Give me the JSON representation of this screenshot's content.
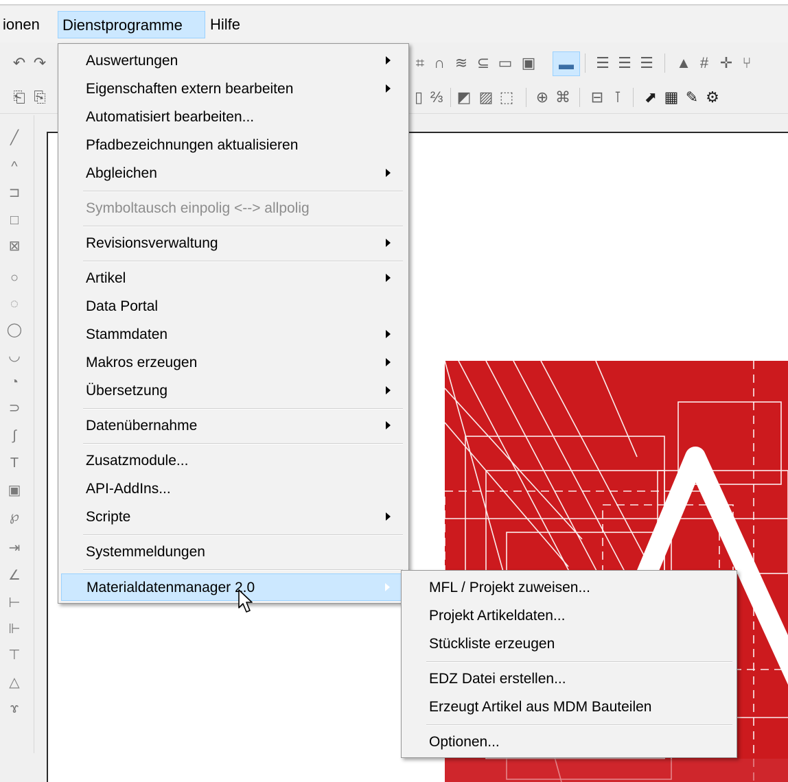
{
  "menubar": {
    "items": [
      "ionen",
      "Dienstprogramme",
      "Hilfe"
    ]
  },
  "main_menu": {
    "items": [
      {
        "label": "Auswertungen",
        "submenu": true
      },
      {
        "label": "Eigenschaften extern bearbeiten",
        "submenu": true
      },
      {
        "label": "Automatisiert bearbeiten...",
        "submenu": false
      },
      {
        "label": "Pfadbezeichnungen aktualisieren",
        "submenu": false
      },
      {
        "label": "Abgleichen",
        "submenu": true
      },
      {
        "label": "Symboltausch einpolig <--> allpolig",
        "submenu": false,
        "disabled": true
      },
      {
        "label": "Revisionsverwaltung",
        "submenu": true
      },
      {
        "label": "Artikel",
        "submenu": true
      },
      {
        "label": "Data Portal",
        "submenu": false
      },
      {
        "label": "Stammdaten",
        "submenu": true
      },
      {
        "label": "Makros erzeugen",
        "submenu": true
      },
      {
        "label": "Übersetzung",
        "submenu": true
      },
      {
        "label": "Datenübernahme",
        "submenu": true
      },
      {
        "label": "Zusatzmodule...",
        "submenu": false
      },
      {
        "label": "API-AddIns...",
        "submenu": false
      },
      {
        "label": "Scripte",
        "submenu": true
      },
      {
        "label": "Systemmeldungen",
        "submenu": false
      },
      {
        "label": "Materialdatenmanager 2.0",
        "submenu": true,
        "highlighted": true
      }
    ]
  },
  "sub_menu": {
    "items": [
      {
        "label": "MFL / Projekt zuweisen..."
      },
      {
        "label": "Projekt Artikeldaten..."
      },
      {
        "label": "Stückliste erzeugen"
      },
      {
        "label": "EDZ Datei erstellen..."
      },
      {
        "label": "Erzeugt Artikel aus MDM Bauteilen"
      },
      {
        "label": "Optionen..."
      }
    ]
  },
  "colors": {
    "menu_bg": "#f2f2f2",
    "highlight_bg": "#cce8ff",
    "highlight_border": "#99d1ff",
    "logo_red": "#cc1a1e"
  },
  "icons": {
    "toolbar": [
      "undo-icon",
      "redo-icon",
      "page-icon",
      "connect-icon",
      "scale-icon",
      "grid-icon",
      "export-icon",
      "table-icon",
      "script-icon",
      "settings-icon"
    ],
    "left_tools": [
      "line-icon",
      "polyline-icon",
      "rectangle-icon",
      "circle-icon",
      "arc-icon",
      "text-icon",
      "image-icon",
      "dimension-icon"
    ]
  }
}
